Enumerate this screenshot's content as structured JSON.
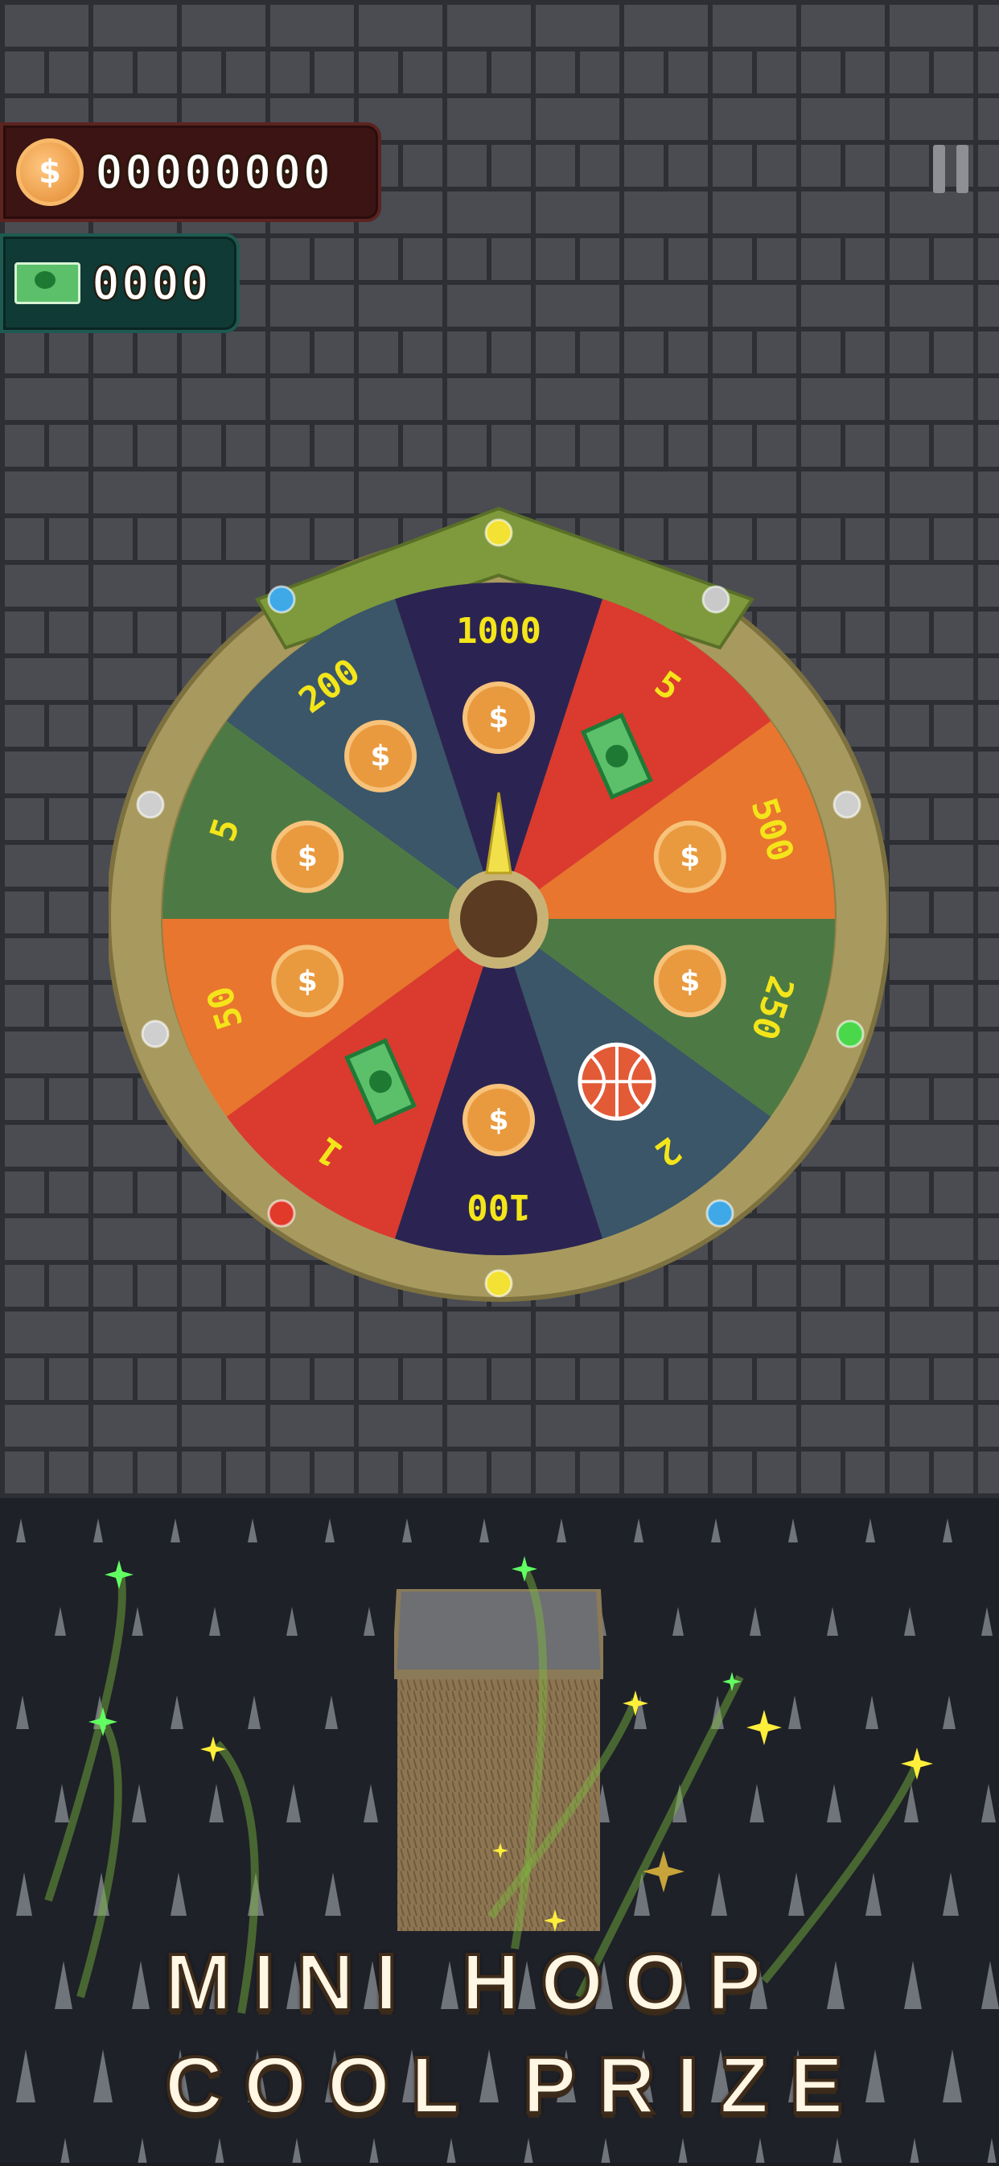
{
  "hud": {
    "coins": "00000000",
    "cash": "0000"
  },
  "wheel": {
    "segments": [
      {
        "label": "1000",
        "prize": "coin",
        "color": "#2b2452"
      },
      {
        "label": "5",
        "prize": "cash",
        "color": "#db3a2f"
      },
      {
        "label": "500",
        "prize": "coin",
        "color": "#e8762e"
      },
      {
        "label": "250",
        "prize": "coin",
        "color": "#4d7a44"
      },
      {
        "label": "2",
        "prize": "basketball",
        "color": "#3a5668"
      },
      {
        "label": "100",
        "prize": "coin",
        "color": "#2b2452"
      },
      {
        "label": "1",
        "prize": "cash",
        "color": "#db3a2f"
      },
      {
        "label": "50",
        "prize": "coin",
        "color": "#e8762e"
      },
      {
        "label": "5",
        "prize": "coin",
        "color": "#4d7a44"
      },
      {
        "label": "200",
        "prize": "coin",
        "color": "#3a5668"
      }
    ],
    "rim_color": "#b6a66a",
    "label_color": "#f4e51a"
  },
  "title": {
    "line1": "MINI HOOP",
    "line2": "COOL PRIZE"
  }
}
